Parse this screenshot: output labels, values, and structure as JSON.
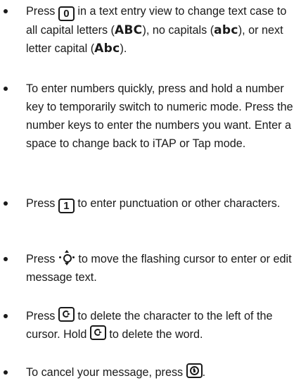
{
  "tips": [
    {
      "p1": "Press ",
      "key": "0",
      "p2": " in a text entry view to change text case to all capital letters (",
      "case_upper": "ABC",
      "p3": "), no capitals (",
      "case_lower": "abc",
      "p4": "), or next letter capital (",
      "case_title": "Abc",
      "p5": ")."
    },
    {
      "text": "To enter numbers quickly, press and hold a number key to temporarily switch to numeric mode. Press the number keys to enter the numbers you want. Enter a space to change back to iTAP or Tap mode."
    },
    {
      "p1": "Press ",
      "key": "1",
      "p2": " to enter punctuation or other characters.",
      "icon": "number-1-key-icon"
    },
    {
      "p1": "Press ",
      "icon": "navigation-key-icon",
      "p2": " to move the flashing cursor to enter or edit message text."
    },
    {
      "p1": "Press ",
      "icon": "clear-key-icon",
      "p2": " to delete the character to the left of the cursor. Hold ",
      "p3": " to delete the word."
    },
    {
      "p1": "To cancel your message, press ",
      "icon": "end-key-icon",
      "p2": "."
    }
  ]
}
